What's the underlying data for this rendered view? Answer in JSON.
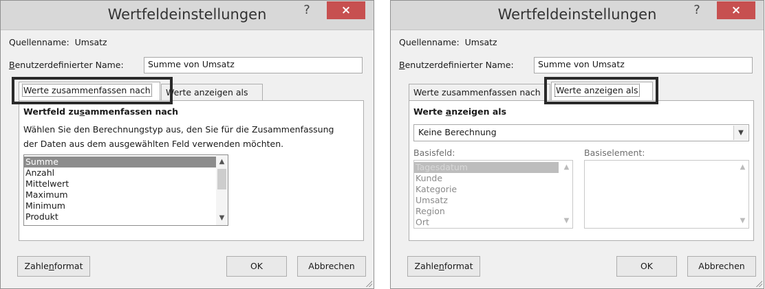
{
  "dialog1": {
    "title": "Wertfeldeinstellungen",
    "help": "?",
    "close": "×",
    "source_label": "Quellenname:",
    "source_value": "Umsatz",
    "custom_name_label_u": "B",
    "custom_name_label_rest": "enutzerdefinierter Name:",
    "custom_name_value": "Summe von Umsatz",
    "tabs": [
      "Werte zusammenfassen nach",
      "Werte anzeigen als"
    ],
    "section_heading_pre": "Wertfeld zu",
    "section_heading_u": "s",
    "section_heading_post": "ammenfassen nach",
    "description_line1": "Wählen Sie den Berechnungstyp aus, den Sie für die Zusammenfassung",
    "description_line2": "der Daten aus dem ausgewählten Feld verwenden möchten.",
    "functions": [
      "Summe",
      "Anzahl",
      "Mittelwert",
      "Maximum",
      "Minimum",
      "Produkt"
    ],
    "selected_function": "Summe",
    "number_format_pre": "Zahle",
    "number_format_u": "n",
    "number_format_post": "format",
    "ok": "OK",
    "cancel": "Abbrechen"
  },
  "dialog2": {
    "title": "Wertfeldeinstellungen",
    "help": "?",
    "close": "×",
    "source_label": "Quellenname:",
    "source_value": "Umsatz",
    "custom_name_label_u": "B",
    "custom_name_label_rest": "enutzerdefinierter Name:",
    "custom_name_value": "Summe von Umsatz",
    "tabs": [
      "Werte zusammenfassen nach",
      "Werte anzeigen als"
    ],
    "section_heading_pre": "Werte ",
    "section_heading_u": "a",
    "section_heading_post": "nzeigen als",
    "calculation_value": "Keine Berechnung",
    "base_field_label": "Basisfeld:",
    "base_item_label": "Basiselement:",
    "base_fields": [
      "Tagesdatum",
      "Kunde",
      "Kategorie",
      "Umsatz",
      "Region",
      "Ort"
    ],
    "selected_base_field": "Tagesdatum",
    "number_format_pre": "Zahle",
    "number_format_u": "n",
    "number_format_post": "format",
    "ok": "OK",
    "cancel": "Abbrechen"
  },
  "icons": {
    "close": "close-icon",
    "help": "help-icon",
    "scroll_up": "chevron-up-icon",
    "scroll_down": "chevron-down-icon",
    "dropdown": "chevron-down-icon"
  },
  "colors": {
    "close_button": "#c75050",
    "selection": "#8c8c8c",
    "highlight_frame": "#2a2a2a"
  }
}
